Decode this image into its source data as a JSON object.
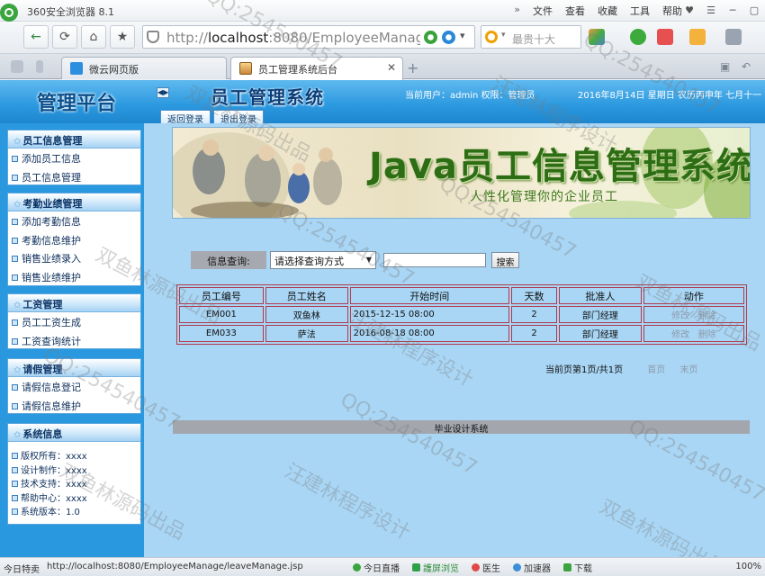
{
  "browser": {
    "app_name": "360安全浏览器 8.1",
    "menu": [
      "文件",
      "查看",
      "收藏",
      "工具",
      "帮助"
    ],
    "menu_chevron": "»",
    "url_host": "localhost",
    "url_rest": ":8080/EmployeeManage/ma",
    "search_placeholder": "最贵十大",
    "tabs": [
      {
        "label": "微云网页版",
        "active": false
      },
      {
        "label": "员工管理系统后台",
        "active": true
      }
    ],
    "new_tab": "+"
  },
  "app": {
    "brand": "管理平台",
    "system_title": "员工管理系统",
    "user_info": "当前用户：admin 权限：管理员",
    "date_info": "2016年8月14日 星期日 农历丙申年 七月十一",
    "top_tabs": [
      "返回登录",
      "退出登录"
    ]
  },
  "sidebar": {
    "panels": [
      {
        "title": "员工信息管理",
        "items": [
          "添加员工信息",
          "员工信息管理"
        ]
      },
      {
        "title": "考勤业绩管理",
        "items": [
          "添加考勤信息",
          "考勤信息维护",
          "销售业绩录入",
          "销售业绩维护"
        ]
      },
      {
        "title": "工资管理",
        "items": [
          "员工工资生成",
          "工资查询统计"
        ]
      },
      {
        "title": "请假管理",
        "items": [
          "请假信息登记",
          "请假信息维护"
        ]
      },
      {
        "title": "系统信息",
        "info": [
          "版权所有：xxxx",
          "设计制作：xxxx",
          "技术支持：xxxx",
          "帮助中心：xxxx",
          "系统版本：1.0"
        ]
      }
    ]
  },
  "banner": {
    "title": "Java员工信息管理系统",
    "subtitle": "人性化管理你的企业员工"
  },
  "search": {
    "label": "信息查询:",
    "select_value": "请选择查询方式",
    "input_value": "",
    "button": "搜索"
  },
  "table": {
    "headers": [
      "员工编号",
      "员工姓名",
      "开始时间",
      "天数",
      "批准人",
      "动作"
    ],
    "rows": [
      {
        "id": "EM001",
        "name": "双鱼林",
        "start": "2015-12-15 08:00",
        "days": "2",
        "approver": "部门经理",
        "edit": "修改",
        "delete": "删除"
      },
      {
        "id": "EM033",
        "name": "萨法",
        "start": "2016-08-18 08:00",
        "days": "2",
        "approver": "部门经理",
        "edit": "修改",
        "delete": "删除"
      }
    ]
  },
  "pager": {
    "text": "当前页第1页/共1页",
    "first": "首页",
    "last": "末页"
  },
  "footer": "毕业设计系统",
  "watermark": [
    "QQ:254540457",
    "汪建林程序设计",
    "双鱼林源码出品"
  ],
  "statusbar": {
    "left": "今日特卖",
    "url": "http://localhost:8080/EmployeeManage/leaveManage.jsp",
    "items": [
      "今日直播",
      "護屏浏览",
      "医生",
      "加速器",
      "下载"
    ],
    "zoom": "100%"
  }
}
